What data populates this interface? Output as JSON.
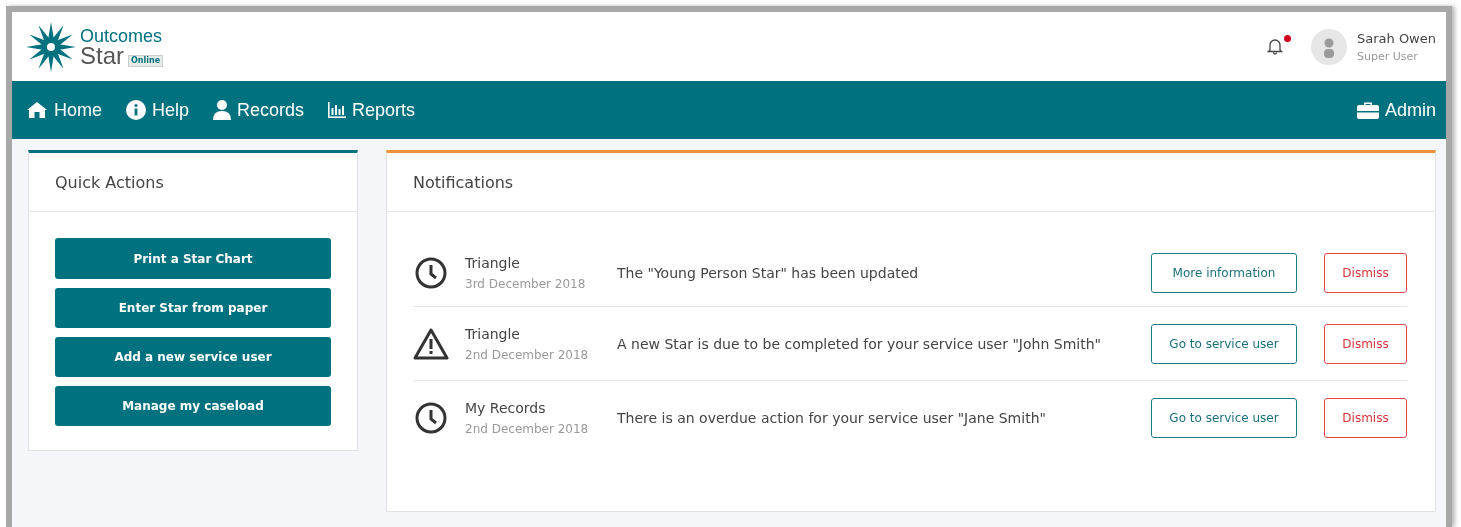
{
  "logo": {
    "line_1": "Outcomes",
    "line_2": "Star",
    "tag": "Online"
  },
  "notifications_bell": {
    "unread": true
  },
  "user": {
    "name": "Sarah Owen",
    "role": "Super User"
  },
  "nav": {
    "items": [
      {
        "label": "Home",
        "kind": "home"
      },
      {
        "label": "Help",
        "kind": "help"
      },
      {
        "label": "Records",
        "kind": "records"
      },
      {
        "label": "Reports",
        "kind": "reports"
      }
    ],
    "admin": {
      "label": "Admin",
      "kind": "admin"
    }
  },
  "quick_actions": {
    "title": "Quick Actions",
    "buttons": [
      "Print a Star Chart",
      "Enter Star from paper",
      "Add a new service user",
      "Manage my caseload"
    ]
  },
  "notifications": {
    "title": "Notifications",
    "items": [
      {
        "kind": "clock",
        "source": "Triangle",
        "date": "3rd December 2018",
        "message": "The \"Young Person Star\" has been updated",
        "action": "More information",
        "dismiss": "Dismiss"
      },
      {
        "kind": "warning",
        "source": "Triangle",
        "date": "2nd December 2018",
        "message": "A new Star is due to be completed for your service user \"John Smith\"",
        "action": "Go to service user",
        "dismiss": "Dismiss"
      },
      {
        "kind": "clock",
        "source": "My Records",
        "date": "2nd December 2018",
        "message": "There is an overdue action for your service user \"Jane Smith\"",
        "action": "Go to service user",
        "dismiss": "Dismiss"
      }
    ]
  }
}
